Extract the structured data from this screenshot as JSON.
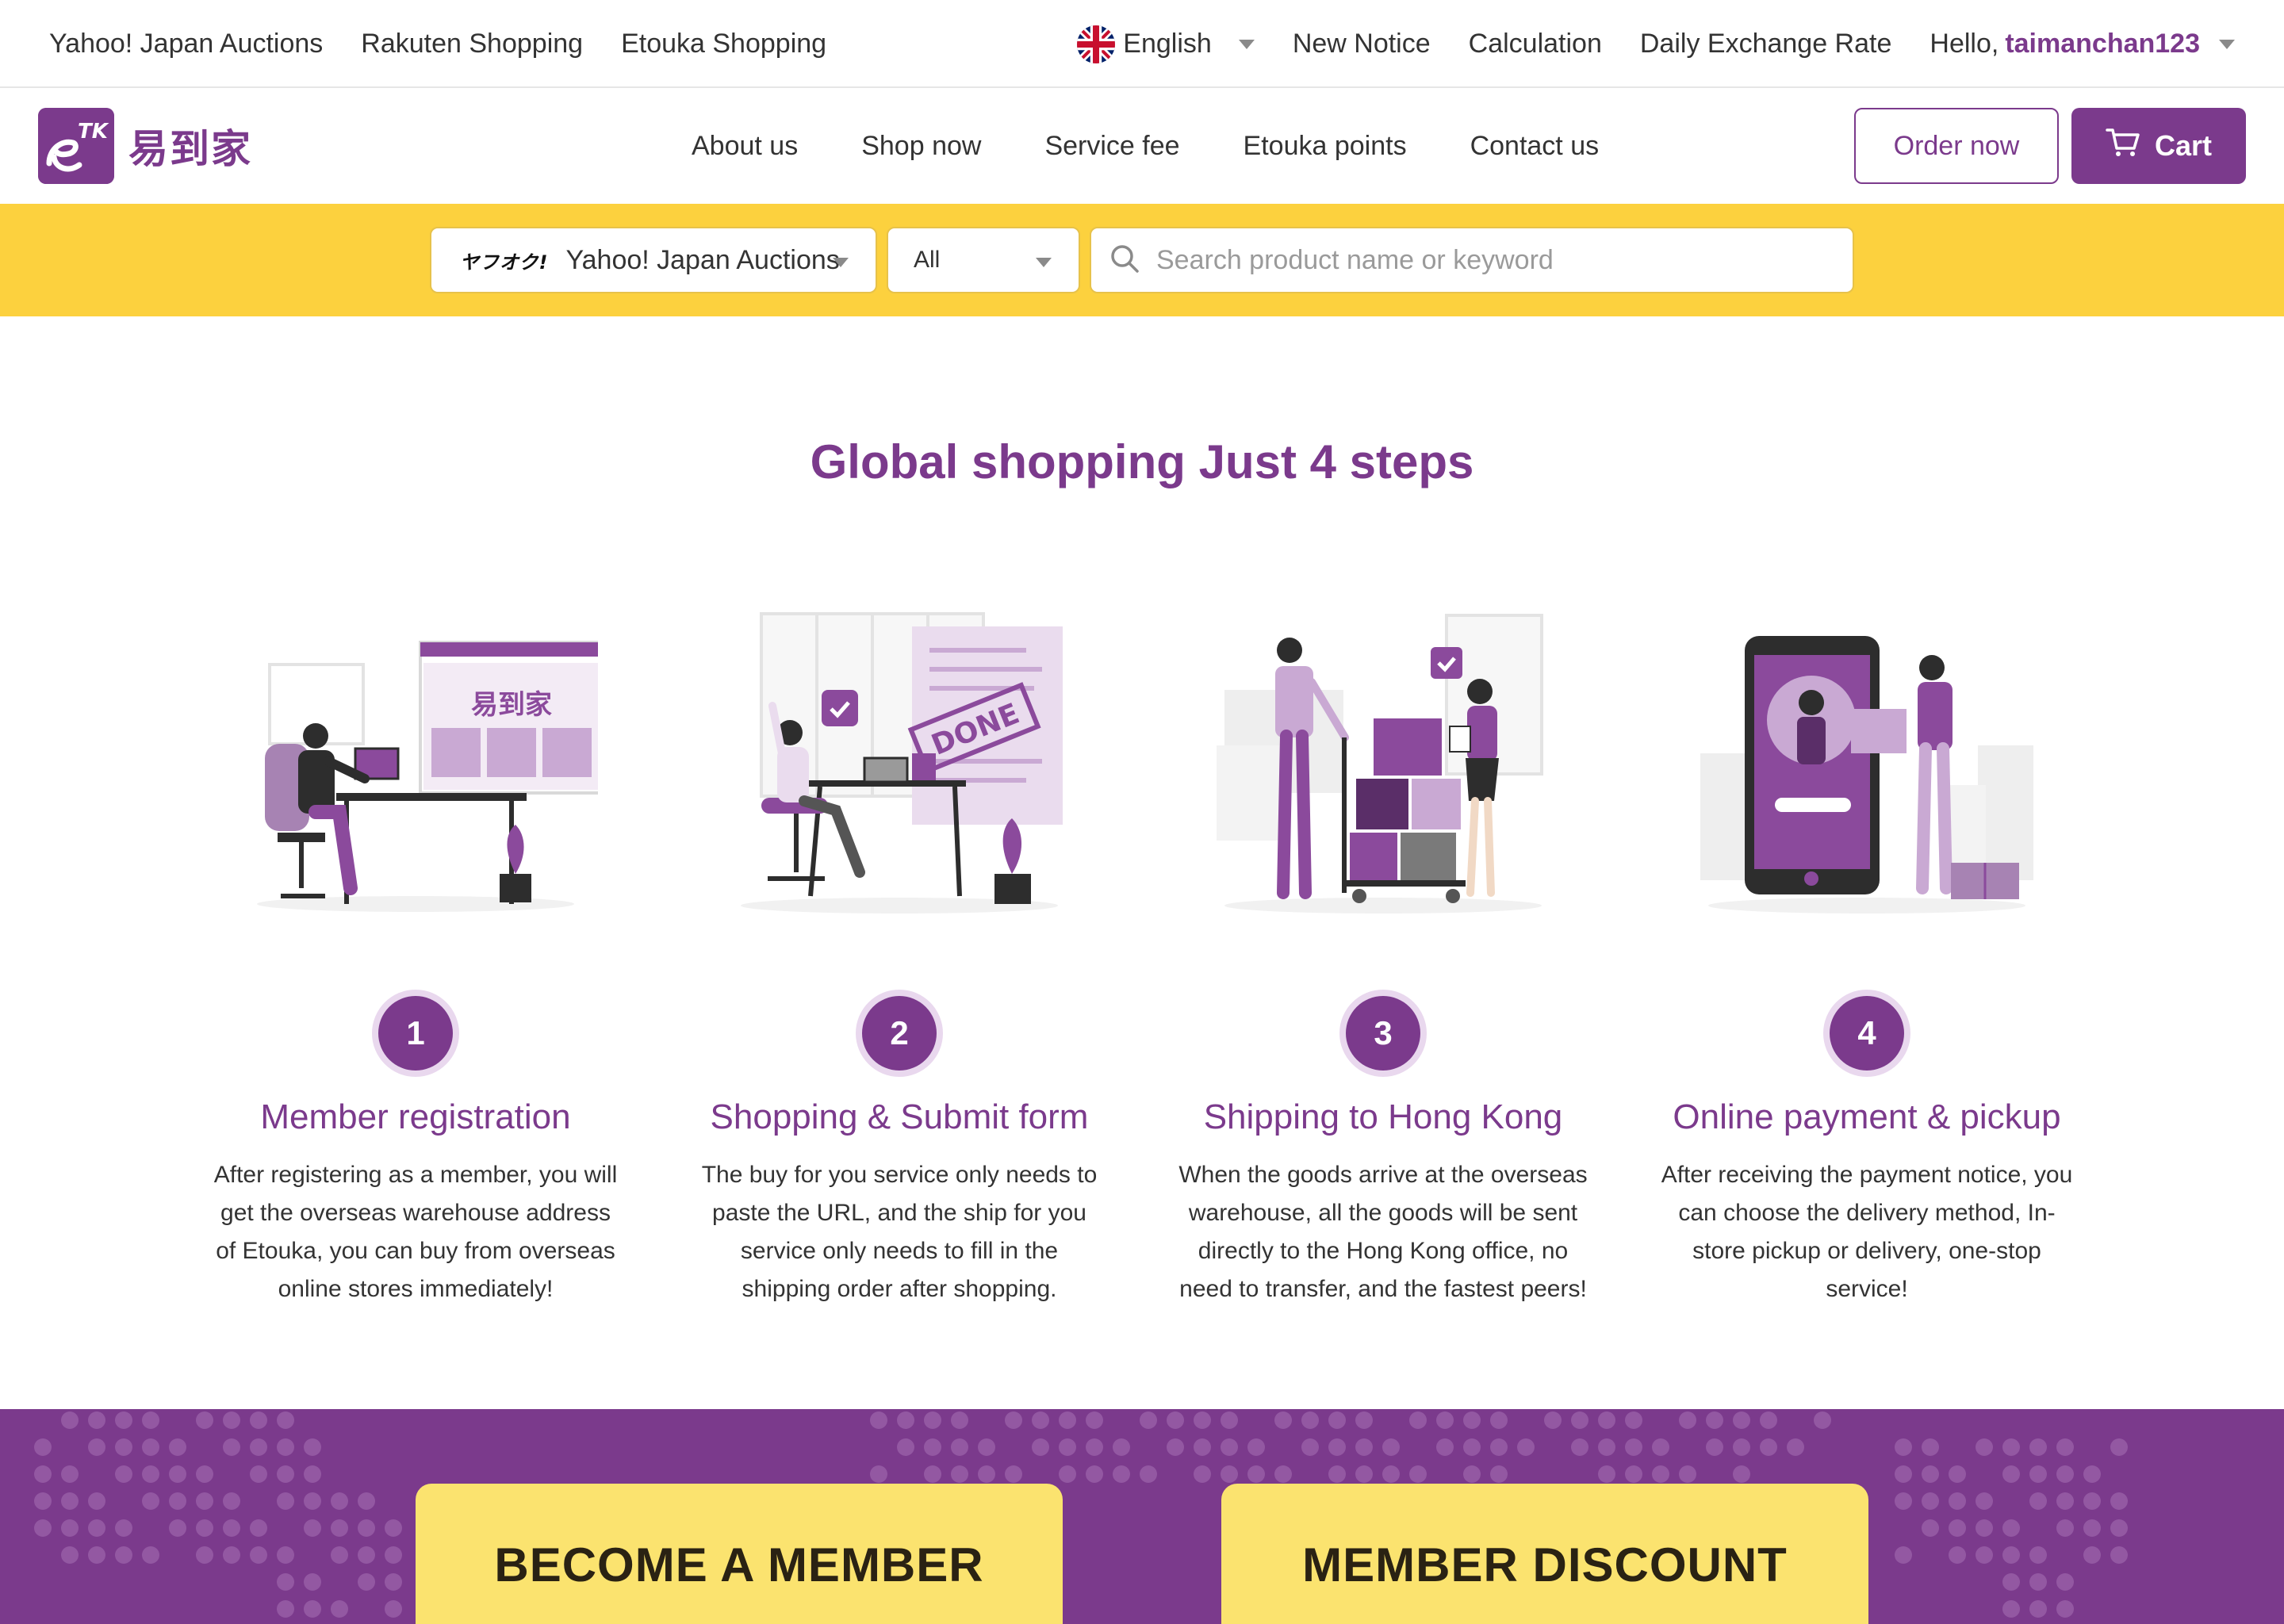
{
  "topbar": {
    "left_links": [
      "Yahoo! Japan Auctions",
      "Rakuten Shopping",
      "Etouka Shopping"
    ],
    "language": "English",
    "right_links": [
      "New Notice",
      "Calculation",
      "Daily Exchange Rate"
    ],
    "greeting": "Hello,",
    "username": "taimanchan123"
  },
  "nav": {
    "logo_text": "易到家",
    "logo_mark": "eTK",
    "links": [
      "About us",
      "Shop now",
      "Service fee",
      "Etouka points",
      "Contact us"
    ],
    "order_button": "Order now",
    "cart_button": "Cart"
  },
  "search": {
    "site_logo": "ヤフオク!",
    "site_selected": "Yahoo! Japan Auctions",
    "category_selected": "All",
    "placeholder": "Search product name or keyword"
  },
  "steps_section": {
    "heading": "Global shopping Just 4 steps",
    "steps": [
      {
        "number": "1",
        "title": "Member registration",
        "text": "After registering as a member, you will get the overseas warehouse address of Etouka, you can buy from overseas online stores immediately!",
        "illustration": "computer-registration-illustration",
        "illustration_text": "易到家"
      },
      {
        "number": "2",
        "title": "Shopping & Submit form",
        "text": "The buy for you service only needs to paste the URL, and the ship for you service only needs to fill in the shipping order after shopping.",
        "illustration": "done-form-illustration",
        "illustration_text": "DONE"
      },
      {
        "number": "3",
        "title": "Shipping to Hong Kong",
        "text": "When the goods arrive at the overseas warehouse, all the goods will be sent directly to the Hong Kong office, no need to transfer, and the fastest peers!",
        "illustration": "shipping-boxes-illustration"
      },
      {
        "number": "4",
        "title": "Online payment & pickup",
        "text": "After receiving the payment notice, you can choose the delivery method, In-store pickup or delivery, one-stop service!",
        "illustration": "phone-payment-illustration"
      }
    ]
  },
  "cta": {
    "become_member": "BECOME A MEMBER",
    "member_discount": "MEMBER DISCOUNT"
  },
  "colors": {
    "brand_purple": "#7b3a8c",
    "accent_yellow": "#fcd13e",
    "cta_yellow": "#fbe36f"
  }
}
